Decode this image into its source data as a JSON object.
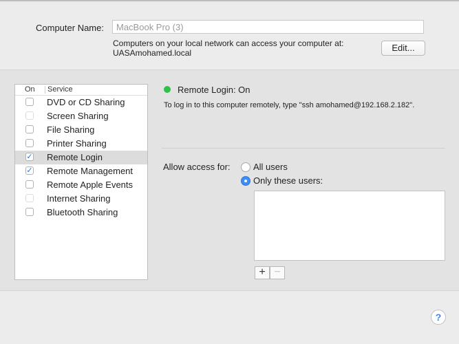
{
  "computer_name": {
    "label": "Computer Name:",
    "value": "MacBook Pro (3)",
    "info_line1": "Computers on your local network can access your computer at:",
    "info_line2": "UASAmohamed.local",
    "edit_label": "Edit..."
  },
  "services": {
    "header_on": "On",
    "header_service": "Service",
    "items": [
      {
        "label": "DVD or CD Sharing",
        "checked": false,
        "selected": false,
        "disabled": false
      },
      {
        "label": "Screen Sharing",
        "checked": false,
        "selected": false,
        "disabled": true
      },
      {
        "label": "File Sharing",
        "checked": false,
        "selected": false,
        "disabled": false
      },
      {
        "label": "Printer Sharing",
        "checked": false,
        "selected": false,
        "disabled": false
      },
      {
        "label": "Remote Login",
        "checked": true,
        "selected": true,
        "disabled": false
      },
      {
        "label": "Remote Management",
        "checked": true,
        "selected": false,
        "disabled": false
      },
      {
        "label": "Remote Apple Events",
        "checked": false,
        "selected": false,
        "disabled": false
      },
      {
        "label": "Internet Sharing",
        "checked": false,
        "selected": false,
        "disabled": true
      },
      {
        "label": "Bluetooth Sharing",
        "checked": false,
        "selected": false,
        "disabled": false
      }
    ]
  },
  "detail": {
    "status_text": "Remote Login: On",
    "status_color": "#2fc14a",
    "instructions": "To log in to this computer remotely, type \"ssh amohamed@192.168.2.182\".",
    "access_label": "Allow access for:",
    "option_all": "All users",
    "option_only": "Only these users:",
    "selected_option": "only",
    "add_symbol": "+",
    "remove_symbol": "−"
  },
  "help": {
    "symbol": "?"
  },
  "colors": {
    "accent": "#3d8df5",
    "check": "#1a73e8"
  }
}
